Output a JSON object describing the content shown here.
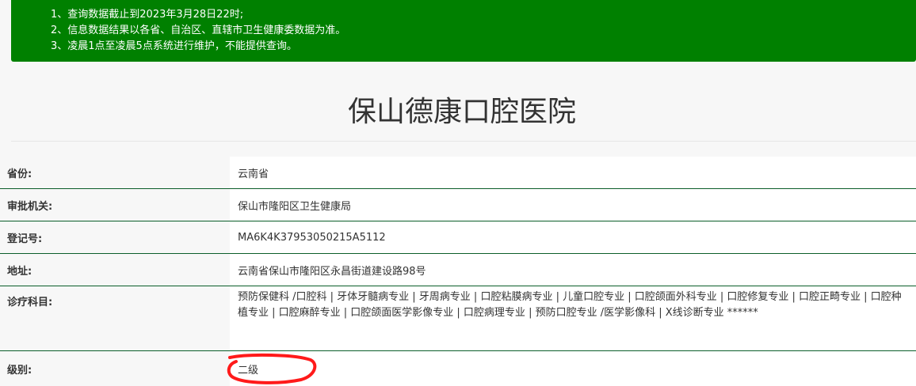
{
  "notice": {
    "lines": [
      "1、查询数据截止到2023年3月28日22时;",
      "2、信息数据结果以各省、自治区、直辖市卫生健康委数据为准。",
      "3、凌晨1点至凌晨5点系统进行维护，不能提供查询。"
    ]
  },
  "title": "保山德康口腔医院",
  "rows": [
    {
      "label": "省份:",
      "value": "云南省"
    },
    {
      "label": "审批机关:",
      "value": "保山市隆阳区卫生健康局"
    },
    {
      "label": "登记号:",
      "value": "MA6K4K37953050215A5112"
    },
    {
      "label": "地址:",
      "value": "云南省保山市隆阳区永昌街道建设路98号"
    },
    {
      "label": "诊疗科目:",
      "value": "预防保健科 /口腔科 | 牙体牙髓病专业 | 牙周病专业 | 口腔粘膜病专业 | 儿童口腔专业 | 口腔颌面外科专业 | 口腔修复专业 | 口腔正畸专业 | 口腔种植专业 | 口腔麻醉专业 | 口腔颌面医学影像专业 | 口腔病理专业 | 预防口腔专业 /医学影像科 | X线诊断专业 ******"
    },
    {
      "label": "级别:",
      "value": "二级"
    }
  ],
  "annotation": {
    "color": "#ff1a1a"
  }
}
